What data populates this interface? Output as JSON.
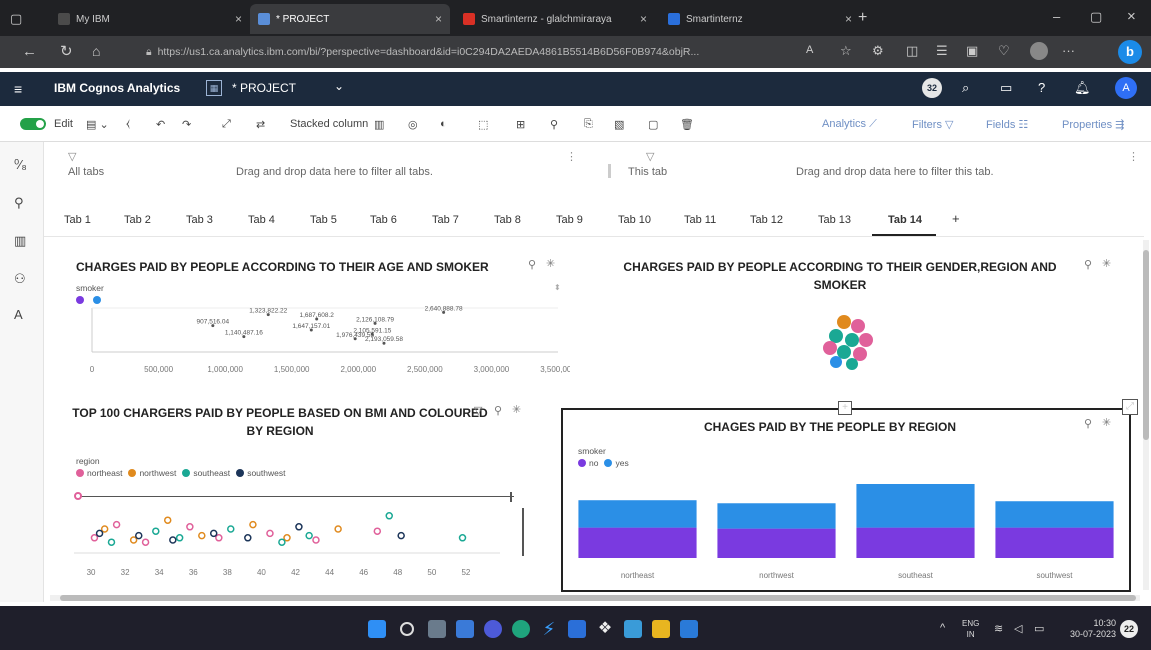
{
  "browser": {
    "tabs": [
      {
        "label": "My IBM"
      },
      {
        "label": "* PROJECT"
      },
      {
        "label": "Smartinternz - glalchmiraraya"
      },
      {
        "label": "Smartinternz"
      }
    ],
    "url": "https://us1.ca.analytics.ibm.com/bi/?perspective=dashboard&id=i0C294DA2AEDA4861B5514B6D56F0B974&objR..."
  },
  "app": {
    "name": "IBM Cognos Analytics",
    "doc_title": "* PROJECT",
    "badge_count": "32"
  },
  "toolbar": {
    "edit_label": "Edit",
    "viz_type": "Stacked column",
    "analytics": "Analytics",
    "filters": "Filters",
    "fields": "Fields",
    "properties": "Properties"
  },
  "filters": {
    "all_tabs": "All tabs",
    "all_tabs_hint": "Drag and drop data here to filter all tabs.",
    "this_tab": "This tab",
    "this_tab_hint": "Drag and drop data here to filter this tab."
  },
  "dashboard_tabs": [
    "Tab 1",
    "Tab 2",
    "Tab 3",
    "Tab 4",
    "Tab 5",
    "Tab 6",
    "Tab 7",
    "Tab 8",
    "Tab 9",
    "Tab 10",
    "Tab 11",
    "Tab 12",
    "Tab 13",
    "Tab 14"
  ],
  "add_tab": "+",
  "panels": {
    "p1": {
      "title": "CHARGES PAID BY PEOPLE ACCORDING TO THEIR AGE AND SMOKER",
      "legend_title": "smoker",
      "point_labels": [
        "907,516.04",
        "1,323,822.22",
        "1,687,608.2",
        "1,647,157.01",
        "2,126,108.79",
        "2,640,888.78",
        "1,140,487.16",
        "2,105,591.15",
        "2,193,059.58",
        "1,976,439.55"
      ]
    },
    "p2": {
      "title": "CHARGES PAID BY PEOPLE ACCORDING TO THEIR GENDER,REGION AND SMOKER"
    },
    "p3": {
      "title": "TOP 100 CHARGERS PAID BY PEOPLE BASED ON BMI AND COLOURED BY REGION",
      "legend_title": "region",
      "legend": [
        "northeast",
        "northwest",
        "southeast",
        "southwest"
      ],
      "legend_colors": [
        "#e0609a",
        "#e08a1e",
        "#1aa894",
        "#1c3559"
      ]
    },
    "p4": {
      "title": "CHAGES PAID BY THE PEOPLE BY REGION",
      "legend_title": "smoker",
      "legend": [
        "no",
        "yes"
      ],
      "legend_colors": [
        "#7a3ae0",
        "#2b8fe6"
      ]
    }
  },
  "chart_data": [
    {
      "type": "scatter",
      "title": "CHARGES PAID BY PEOPLE ACCORDING TO THEIR AGE AND SMOKER",
      "xlim": [
        0,
        3500000
      ],
      "x_ticks": [
        "0",
        "500,000",
        "1,000,000",
        "1,500,000",
        "2,000,000",
        "2,500,000",
        "3,000,000",
        "3,500,000"
      ],
      "series": [
        {
          "name": "no",
          "x": [
            907516.04,
            1140487.16,
            1647157.01,
            2193059.58
          ],
          "values": [
            0.6,
            0.35,
            0.5,
            0.2
          ]
        },
        {
          "name": "yes",
          "x": [
            1323822.22,
            1687608.2,
            2126108.79,
            2105591.15,
            2640888.78,
            1976439.55
          ],
          "values": [
            0.85,
            0.75,
            0.65,
            0.4,
            0.9,
            0.3
          ]
        }
      ]
    },
    {
      "type": "scatter",
      "title": "CHARGES PAID BY PEOPLE ACCORDING TO THEIR GENDER,REGION AND SMOKER"
    },
    {
      "type": "scatter",
      "title": "TOP 100 CHARGERS PAID BY PEOPLE BASED ON BMI AND COLOURED BY REGION",
      "xlim": [
        29,
        54
      ],
      "x_ticks": [
        "30",
        "32",
        "34",
        "36",
        "38",
        "40",
        "42",
        "44",
        "46",
        "48",
        "50",
        "52"
      ],
      "series": [
        {
          "name": "northeast",
          "x": [
            30.2,
            31.5,
            33.2,
            35.8,
            37.5,
            40.5,
            43.2,
            46.8
          ],
          "values": [
            0.3,
            0.6,
            0.2,
            0.55,
            0.3,
            0.4,
            0.25,
            0.45
          ]
        },
        {
          "name": "northwest",
          "x": [
            30.8,
            32.5,
            34.5,
            36.5,
            39.5,
            41.5,
            44.5
          ],
          "values": [
            0.5,
            0.25,
            0.7,
            0.35,
            0.6,
            0.3,
            0.5
          ]
        },
        {
          "name": "southeast",
          "x": [
            31.2,
            33.8,
            35.2,
            38.2,
            41.2,
            42.8,
            47.5,
            51.8
          ],
          "values": [
            0.2,
            0.45,
            0.3,
            0.5,
            0.2,
            0.35,
            0.8,
            0.3
          ]
        },
        {
          "name": "southwest",
          "x": [
            30.5,
            32.8,
            34.8,
            37.2,
            39.2,
            42.2,
            48.2
          ],
          "values": [
            0.4,
            0.35,
            0.25,
            0.4,
            0.3,
            0.55,
            0.35
          ]
        }
      ]
    },
    {
      "type": "bar",
      "title": "CHAGES PAID BY THE PEOPLE BY REGION",
      "categories": [
        "northeast",
        "northwest",
        "southeast",
        "southwest"
      ],
      "series": [
        {
          "name": "no",
          "values": [
            30,
            29,
            30,
            30
          ]
        },
        {
          "name": "yes",
          "values": [
            27,
            25,
            43,
            26
          ]
        }
      ]
    }
  ],
  "taskbar": {
    "lang": "ENG",
    "region": "IN",
    "time": "10:30",
    "date": "30-07-2023",
    "notif": "22"
  }
}
